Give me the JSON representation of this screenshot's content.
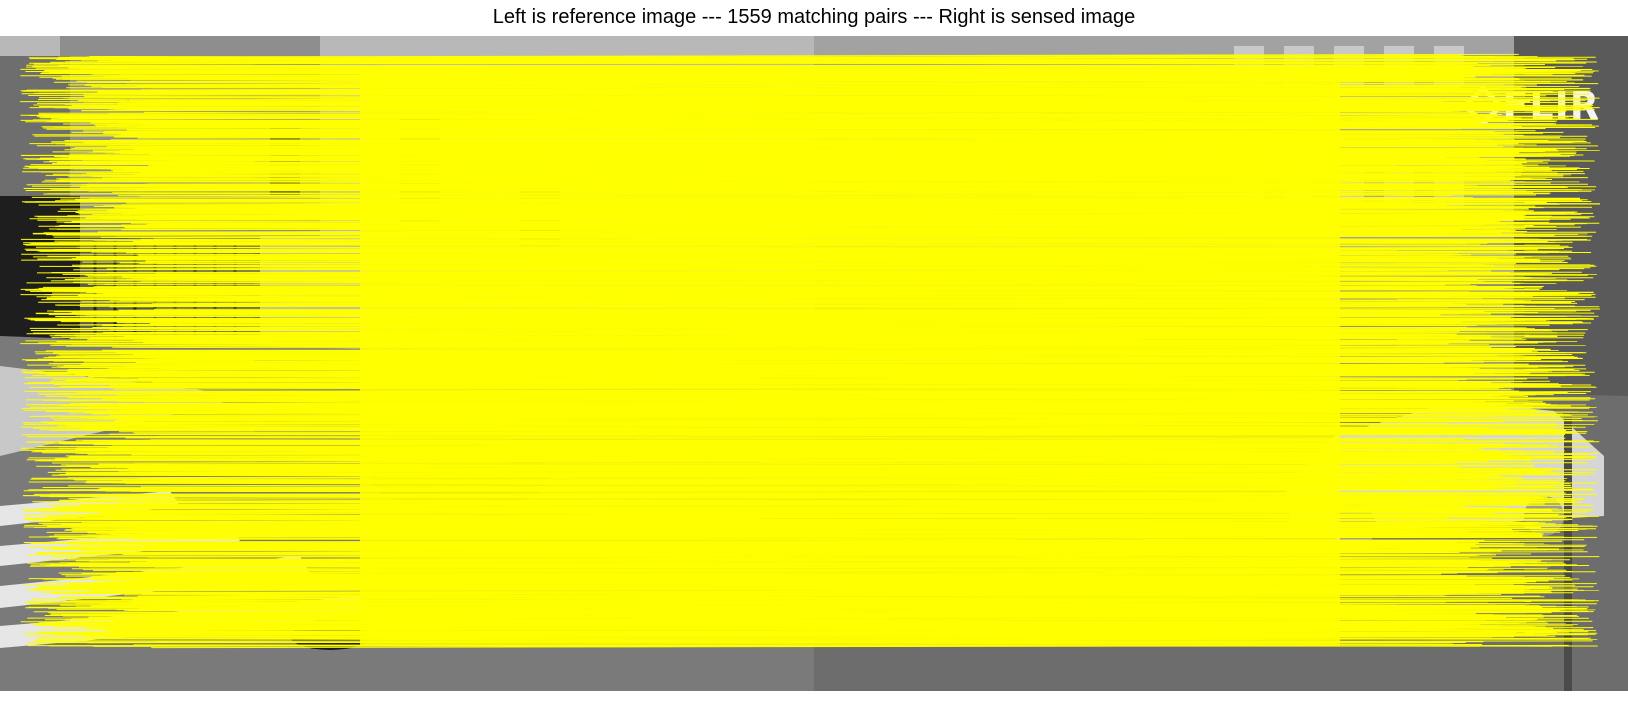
{
  "figure": {
    "title": "Left is reference image --- 1559 matching pairs --- Right is sensed image"
  },
  "panels": {
    "left": {
      "role": "reference image"
    },
    "right": {
      "role": "sensed image",
      "logo_text": "FLIR"
    }
  },
  "matches": {
    "count": 1559,
    "line_color": "#ffff00"
  }
}
